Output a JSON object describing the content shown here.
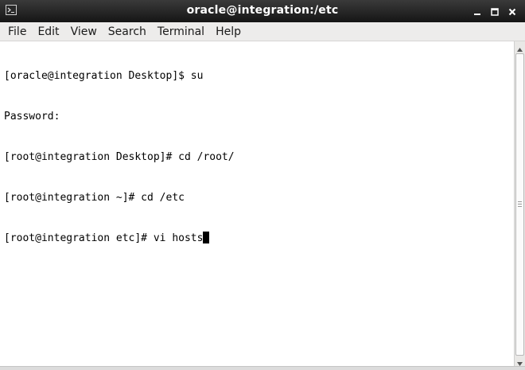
{
  "window": {
    "title": "oracle@integration:/etc",
    "icon": "terminal-icon",
    "buttons": [
      "minimize-icon",
      "maximize-icon",
      "close-icon"
    ]
  },
  "menubar": {
    "items": [
      {
        "label": "File"
      },
      {
        "label": "Edit"
      },
      {
        "label": "View"
      },
      {
        "label": "Search"
      },
      {
        "label": "Terminal"
      },
      {
        "label": "Help"
      }
    ]
  },
  "terminal": {
    "lines": [
      "[oracle@integration Desktop]$ su",
      "Password:",
      "[root@integration Desktop]# cd /root/",
      "[root@integration ~]# cd /etc",
      "[root@integration etc]# vi hosts"
    ],
    "cursor_line": 4
  },
  "colors": {
    "titlebar": "#1e1e1e",
    "menubar": "#edeceb",
    "terminal_bg": "#ffffff",
    "terminal_fg": "#000000"
  }
}
